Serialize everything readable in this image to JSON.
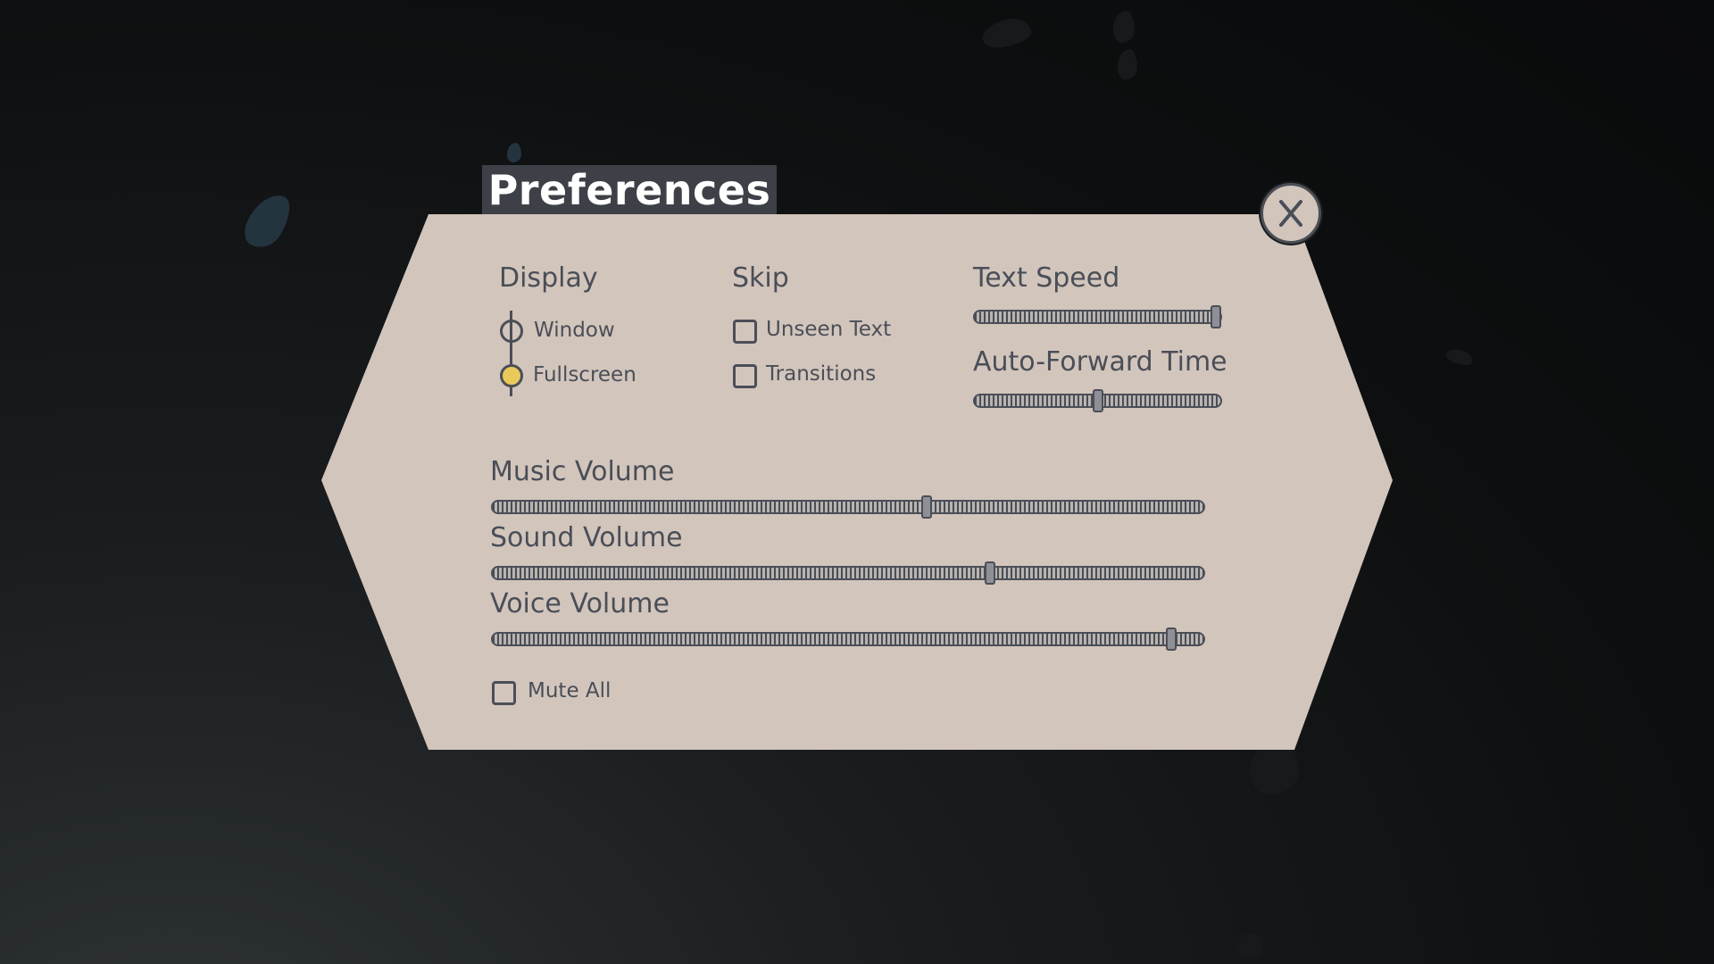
{
  "screen": {
    "title": "Preferences",
    "close_icon": "close-x-icon"
  },
  "display": {
    "heading": "Display",
    "options": [
      {
        "label": "Window",
        "selected": false
      },
      {
        "label": "Fullscreen",
        "selected": true
      }
    ]
  },
  "skip": {
    "heading": "Skip",
    "options": [
      {
        "label": "Unseen Text",
        "checked": false
      },
      {
        "label": "Transitions",
        "checked": false
      }
    ]
  },
  "text_speed": {
    "label": "Text Speed",
    "value": 0.98
  },
  "auto_forward": {
    "label": "Auto-Forward Time",
    "value": 0.5
  },
  "volumes": {
    "music": {
      "label": "Music Volume",
      "value": 0.61
    },
    "sound": {
      "label": "Sound Volume",
      "value": 0.7
    },
    "voice": {
      "label": "Voice Volume",
      "value": 0.955
    }
  },
  "mute_all": {
    "label": "Mute All",
    "checked": false
  },
  "colors": {
    "panel": "#d2c5bc",
    "text": "#4a4e57",
    "accent_selected": "#e8c95a",
    "title_tab": "#3d4147"
  }
}
